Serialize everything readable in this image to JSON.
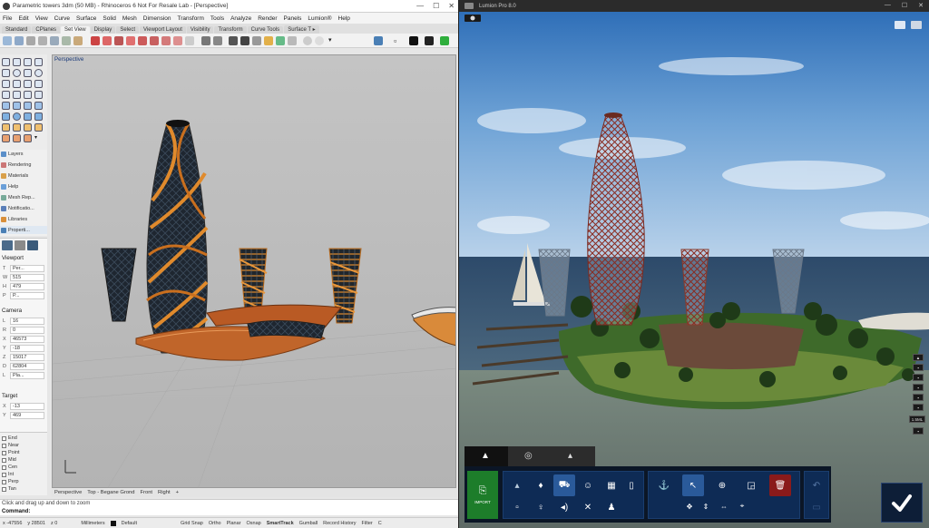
{
  "rhino": {
    "title": "Parametric towers 3dm (50 MB) - Rhinoceros 6 Not For Resale Lab - [Perspective]",
    "window_controls": [
      "—",
      "☐",
      "✕"
    ],
    "menu": [
      "File",
      "Edit",
      "View",
      "Curve",
      "Surface",
      "Solid",
      "Mesh",
      "Dimension",
      "Transform",
      "Tools",
      "Analyze",
      "Render",
      "Panels",
      "Lumion®",
      "Help"
    ],
    "toolbar_tabs": [
      "Standard",
      "CPlanes",
      "Set View",
      "Display",
      "Select",
      "Viewport Layout",
      "Visibility",
      "Transform",
      "Curve Tools",
      "Surface T ▸"
    ],
    "active_toolbar_tab": 2,
    "panel_tabs": [
      "Layers",
      "Rendering",
      "Materials",
      "Help",
      "Mesh Rep...",
      "Notificatio...",
      "Libraries",
      "Properti..."
    ],
    "properties": {
      "viewport_header": "Viewport",
      "viewport_rows": [
        {
          "k": "T",
          "v": "Per..."
        },
        {
          "k": "W",
          "v": "515"
        },
        {
          "k": "H",
          "v": "479"
        },
        {
          "k": "P",
          "v": "P..."
        }
      ],
      "camera_header": "Camera",
      "camera_rows": [
        {
          "k": "L",
          "v": "16"
        },
        {
          "k": "R",
          "v": "0"
        },
        {
          "k": "X",
          "v": "46573"
        },
        {
          "k": "Y",
          "v": "-18"
        },
        {
          "k": "Z",
          "v": "15017"
        },
        {
          "k": "D",
          "v": "62804"
        },
        {
          "k": "L",
          "v": "Pla..."
        }
      ],
      "target_header": "Target",
      "target_rows": [
        {
          "k": "X",
          "v": "-13"
        },
        {
          "k": "Y",
          "v": "469"
        }
      ]
    },
    "osnaps": [
      "End",
      "Near",
      "Point",
      "Mid",
      "Cen",
      "Int",
      "Perp",
      "Tan"
    ],
    "viewport_label": "Perspective",
    "viewport_tabs": [
      "Perspective",
      "Top - Begane Grond",
      "Front",
      "Right",
      "+"
    ],
    "command_hint": "Click and drag up and down to zoom",
    "command_prompt": "Command:",
    "status": {
      "x": "x -47556",
      "y": "y 28501",
      "z": "z 0",
      "units": "Millimeters",
      "layer": "Default",
      "toggles": [
        "Grid Snap",
        "Ortho",
        "Planar",
        "Osnap",
        "SmartTrack",
        "Gumball",
        "Record History",
        "Filter"
      ],
      "extra": "C"
    }
  },
  "lumion": {
    "title": "Lumion Pro 8.0",
    "window_controls": [
      "—",
      "☐",
      "✕"
    ],
    "import_label": "IMPORT",
    "right_side_values": [
      "1.5ML"
    ],
    "colors": {
      "import_green": "#1d7d2a",
      "delete_red": "#8a1a1a",
      "panel_blue": "#0e2b55"
    }
  }
}
